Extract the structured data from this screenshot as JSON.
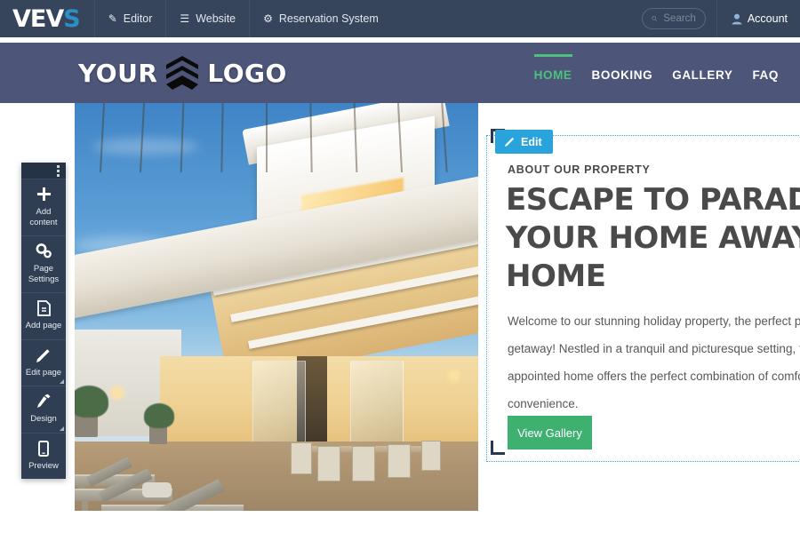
{
  "adminbar": {
    "logo": {
      "part1": "VE",
      "part2": "V",
      "part3": "S"
    },
    "items": [
      {
        "label": "Editor",
        "icon": "pencil-icon",
        "glyph": "✎"
      },
      {
        "label": "Website",
        "icon": "list-icon",
        "glyph": "☰"
      },
      {
        "label": "Reservation System",
        "icon": "gear-icon",
        "glyph": "⚙"
      }
    ],
    "search": {
      "placeholder": "Search",
      "icon": "search-icon",
      "glyph": "⚲"
    },
    "account": {
      "label": "Account",
      "icon": "user-icon",
      "glyph": "♟"
    }
  },
  "siteheader": {
    "brand": {
      "text1": "YOUR",
      "text2": "LOGO",
      "emblem": "chevron-shield-emblem"
    },
    "nav": [
      {
        "label": "HOME",
        "active": true
      },
      {
        "label": "BOOKING",
        "active": false
      },
      {
        "label": "GALLERY",
        "active": false
      },
      {
        "label": "FAQ",
        "active": false
      }
    ],
    "accent_color": "#4cc17e",
    "background_color": "#4d5578"
  },
  "editor_toolbar": {
    "handle_icon": "vertical-dots-icon",
    "items": [
      {
        "label_line1": "Add",
        "label_line2": "content",
        "icon": "plus-icon",
        "glyph": "✚",
        "has_corner": false
      },
      {
        "label_line1": "Page",
        "label_line2": "Settings",
        "icon": "gears-icon",
        "glyph": "⚙",
        "has_corner": false
      },
      {
        "label_line1": "Add page",
        "label_line2": "",
        "icon": "document-icon",
        "glyph": "❑",
        "has_corner": false
      },
      {
        "label_line1": "Edit page",
        "label_line2": "",
        "icon": "pencil-icon",
        "glyph": "✎",
        "has_corner": true
      },
      {
        "label_line1": "Design",
        "label_line2": "",
        "icon": "paintbrush-icon",
        "glyph": "∕",
        "has_corner": true
      },
      {
        "label_line1": "Preview",
        "label_line2": "",
        "icon": "mobile-icon",
        "glyph": "▯",
        "has_corner": false
      }
    ]
  },
  "hero_photo": {
    "alt": "modern white holiday house at dusk with wooden deck, sun loungers and outdoor dining set"
  },
  "content": {
    "edit_button": {
      "label": "Edit",
      "icon": "pencil-icon",
      "glyph": "✎",
      "color": "#29a3dc"
    },
    "eyebrow": "ABOUT OUR PROPERTY",
    "headline_line1": "ESCAPE TO PARADISE",
    "headline_line2": "YOUR HOME AWAY FROM",
    "headline_line3": "HOME",
    "paragraph_line1": "Welcome to our stunning holiday property, the perfect place for",
    "paragraph_line2": "getaway! Nestled in a tranquil and picturesque setting, this be",
    "paragraph_line3": "appointed home offers the perfect combination of comfort, sty",
    "paragraph_line4": "convenience.",
    "cta": {
      "label": "View Gallery",
      "color": "#3eb070"
    },
    "selection_color": "#36a4e0"
  }
}
